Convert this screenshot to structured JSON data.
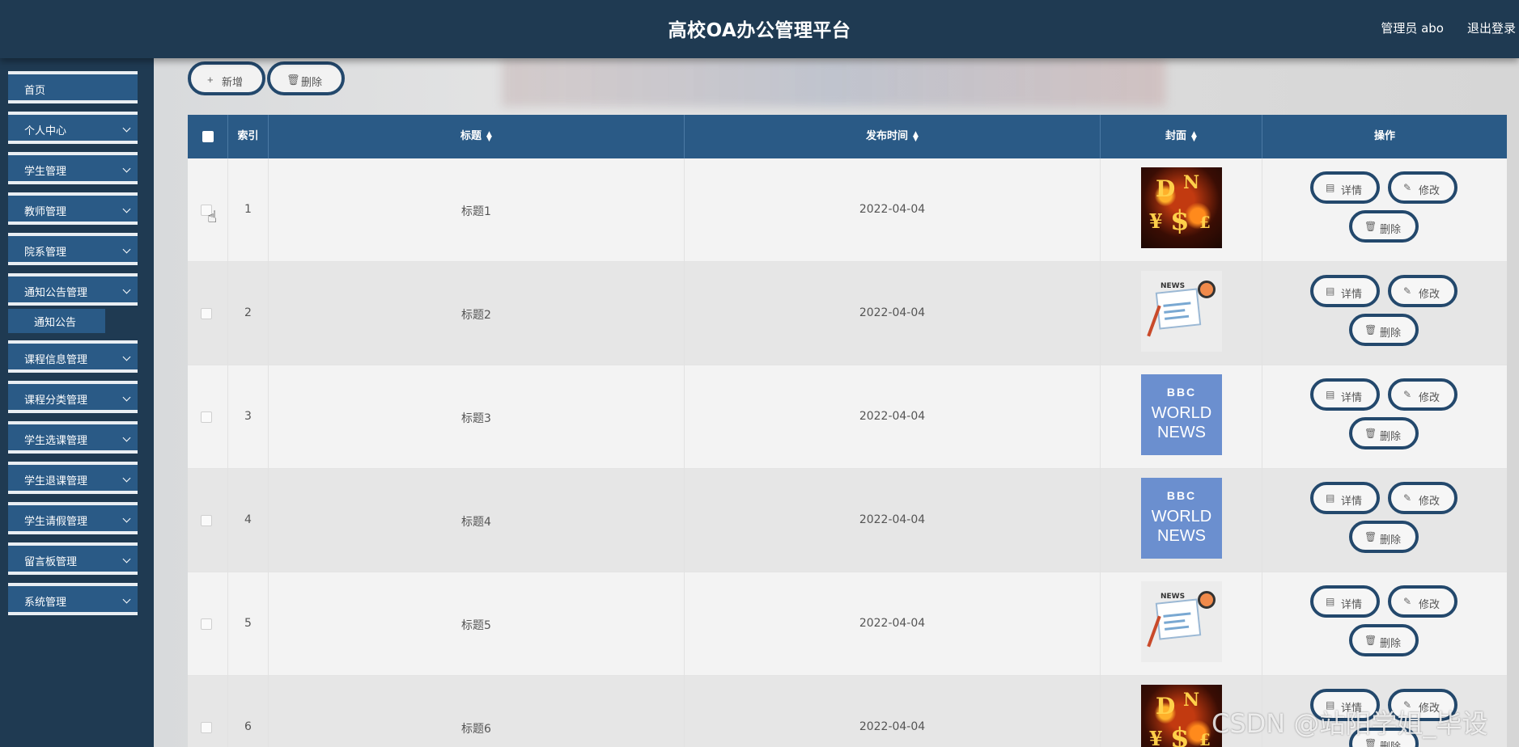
{
  "header": {
    "title": "高校OA办公管理平台",
    "admin": "管理员 abo",
    "logout": "退出登录"
  },
  "sidebar": {
    "items": [
      {
        "label": "首页",
        "has_children": false
      },
      {
        "label": "个人中心",
        "has_children": true
      },
      {
        "label": "学生管理",
        "has_children": true
      },
      {
        "label": "教师管理",
        "has_children": true
      },
      {
        "label": "院系管理",
        "has_children": true
      },
      {
        "label": "通知公告管理",
        "has_children": true
      },
      {
        "label": "课程信息管理",
        "has_children": true
      },
      {
        "label": "课程分类管理",
        "has_children": true
      },
      {
        "label": "学生选课管理",
        "has_children": true
      },
      {
        "label": "学生退课管理",
        "has_children": true
      },
      {
        "label": "学生请假管理",
        "has_children": true
      },
      {
        "label": "留言板管理",
        "has_children": true
      },
      {
        "label": "系统管理",
        "has_children": true
      }
    ],
    "active_sub": "通知公告"
  },
  "toolbar": {
    "add_label": "新增",
    "delete_label": "删除"
  },
  "table": {
    "columns": {
      "index": "索引",
      "title": "标题",
      "date": "发布时间",
      "cover": "封面",
      "actions": "操作"
    },
    "rows": [
      {
        "index": "1",
        "title": "标题1",
        "date": "2022-04-04",
        "cover": "fire-currency-image"
      },
      {
        "index": "2",
        "title": "标题2",
        "date": "2022-04-04",
        "cover": "news-clipart-image"
      },
      {
        "index": "3",
        "title": "标题3",
        "date": "2022-04-04",
        "cover": "bbc-world-news-image"
      },
      {
        "index": "4",
        "title": "标题4",
        "date": "2022-04-04",
        "cover": "bbc-world-news-image"
      },
      {
        "index": "5",
        "title": "标题5",
        "date": "2022-04-04",
        "cover": "news-clipart-image"
      },
      {
        "index": "6",
        "title": "标题6",
        "date": "2022-04-04",
        "cover": "fire-currency-image"
      }
    ],
    "actions": {
      "detail": "详情",
      "edit": "修改",
      "delete": "删除"
    }
  },
  "watermark": "CSDN @站阳学姐_毕设"
}
